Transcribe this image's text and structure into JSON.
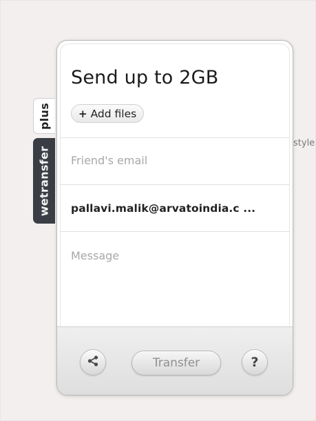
{
  "background": {
    "partial_text": "style"
  },
  "side_tabs": {
    "plus_label": "plus",
    "brand_label": "wetransfer"
  },
  "panel": {
    "title": "Send up to 2GB",
    "add_files_label": "Add files",
    "add_files_icon": "plus-icon",
    "friends_email_placeholder": "Friend's email",
    "your_email_value": "pallavi.malik@arvatoindia.c ...",
    "message_placeholder": "Message"
  },
  "footer": {
    "share_icon": "share-icon",
    "transfer_label": "Transfer",
    "help_label": "?"
  },
  "colors": {
    "page_background": "#f3efef",
    "brand_tab": "#3a3e44",
    "placeholder_text": "#a7a7a7",
    "disabled_button_text": "#8f8f8f"
  }
}
